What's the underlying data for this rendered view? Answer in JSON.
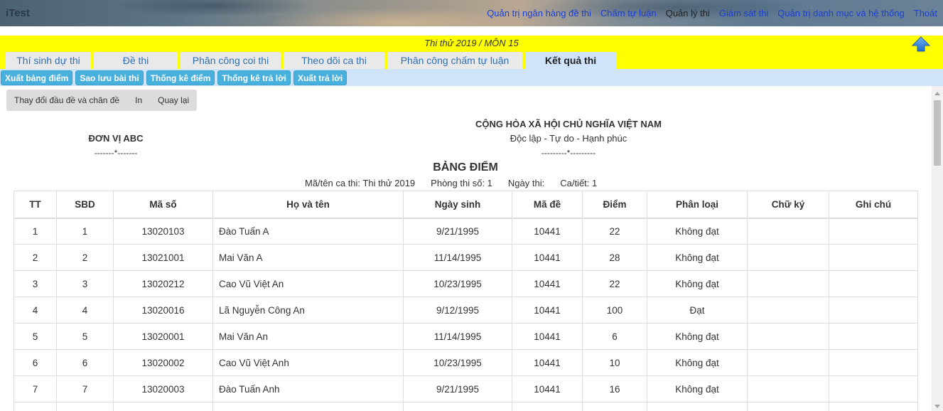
{
  "app": {
    "logo": "iTest"
  },
  "topnav": {
    "items": [
      {
        "label": "Quản trị ngân hàng đề thi"
      },
      {
        "label": "Chấm tự luận"
      },
      {
        "label": "Quản lý thi"
      },
      {
        "label": "Giám sát thi"
      },
      {
        "label": "Quản trị danh mục và hệ thống"
      },
      {
        "label": "Thoát"
      }
    ],
    "current_index": 2
  },
  "header": {
    "exam_title": "Thi thử 2019 / MÔN 15",
    "up_icon": "arrow-up-icon"
  },
  "tabs": [
    {
      "label": "Thí sinh dự thi"
    },
    {
      "label": "Đề thi"
    },
    {
      "label": "Phân công coi thi"
    },
    {
      "label": "Theo dõi ca thi"
    },
    {
      "label": "Phân công chấm tự luận"
    },
    {
      "label": "Kết quả thi"
    }
  ],
  "active_tab": 5,
  "actions": [
    {
      "label": "Xuất bảng điểm"
    },
    {
      "label": "Sao lưu bài thi"
    },
    {
      "label": "Thống kê điểm"
    },
    {
      "label": "Thống kê trả lời"
    },
    {
      "label": "Xuất trả lời"
    }
  ],
  "toolbar": {
    "change_header_footer": "Thay đổi đầu đề và chân đề",
    "print": "In",
    "back": "Quay lại"
  },
  "document": {
    "unit_name": "ĐƠN VỊ ABC",
    "unit_separator": "-------*-------",
    "nation": "CỘNG HÒA XÃ HỘI CHỦ NGHĨA VIỆT NAM",
    "motto": "Độc lập - Tự do - Hạnh phúc",
    "motto_separator": "---------*---------",
    "title": "BẢNG ĐIỂM",
    "meta": {
      "session": "Mã/tên ca thi: Thi thử 2019",
      "room": "Phòng thi số: 1",
      "date": "Ngày thi:",
      "period": "Ca/tiết: 1"
    }
  },
  "table": {
    "columns": [
      "TT",
      "SBD",
      "Mã số",
      "Họ và tên",
      "Ngày sinh",
      "Mã đề",
      "Điểm",
      "Phân loại",
      "Chữ ký",
      "Ghi chú"
    ],
    "rows": [
      [
        "1",
        "1",
        "13020103",
        "Đào Tuấn A",
        "9/21/1995",
        "10441",
        "22",
        "Không đạt",
        "",
        ""
      ],
      [
        "2",
        "2",
        "13021001",
        "Mai Văn A",
        "11/14/1995",
        "10441",
        "28",
        "Không đạt",
        "",
        ""
      ],
      [
        "3",
        "3",
        "13020212",
        "Cao Vũ Việt An",
        "10/23/1995",
        "10441",
        "22",
        "Không đạt",
        "",
        ""
      ],
      [
        "4",
        "4",
        "13020016",
        "Lã Nguyễn Công An",
        "9/12/1995",
        "10441",
        "100",
        "Đạt",
        "",
        ""
      ],
      [
        "5",
        "5",
        "13020001",
        "Mai Văn An",
        "11/14/1995",
        "10441",
        "6",
        "Không đạt",
        "",
        ""
      ],
      [
        "6",
        "6",
        "13020002",
        "Cao Vũ Việt Anh",
        "10/23/1995",
        "10441",
        "10",
        "Không đạt",
        "",
        ""
      ],
      [
        "7",
        "7",
        "13020003",
        "Đào Tuấn Anh",
        "9/21/1995",
        "10441",
        "16",
        "Không đạt",
        "",
        ""
      ],
      [
        "",
        "",
        "",
        "",
        "",
        "",
        "",
        "",
        "",
        ""
      ]
    ]
  }
}
